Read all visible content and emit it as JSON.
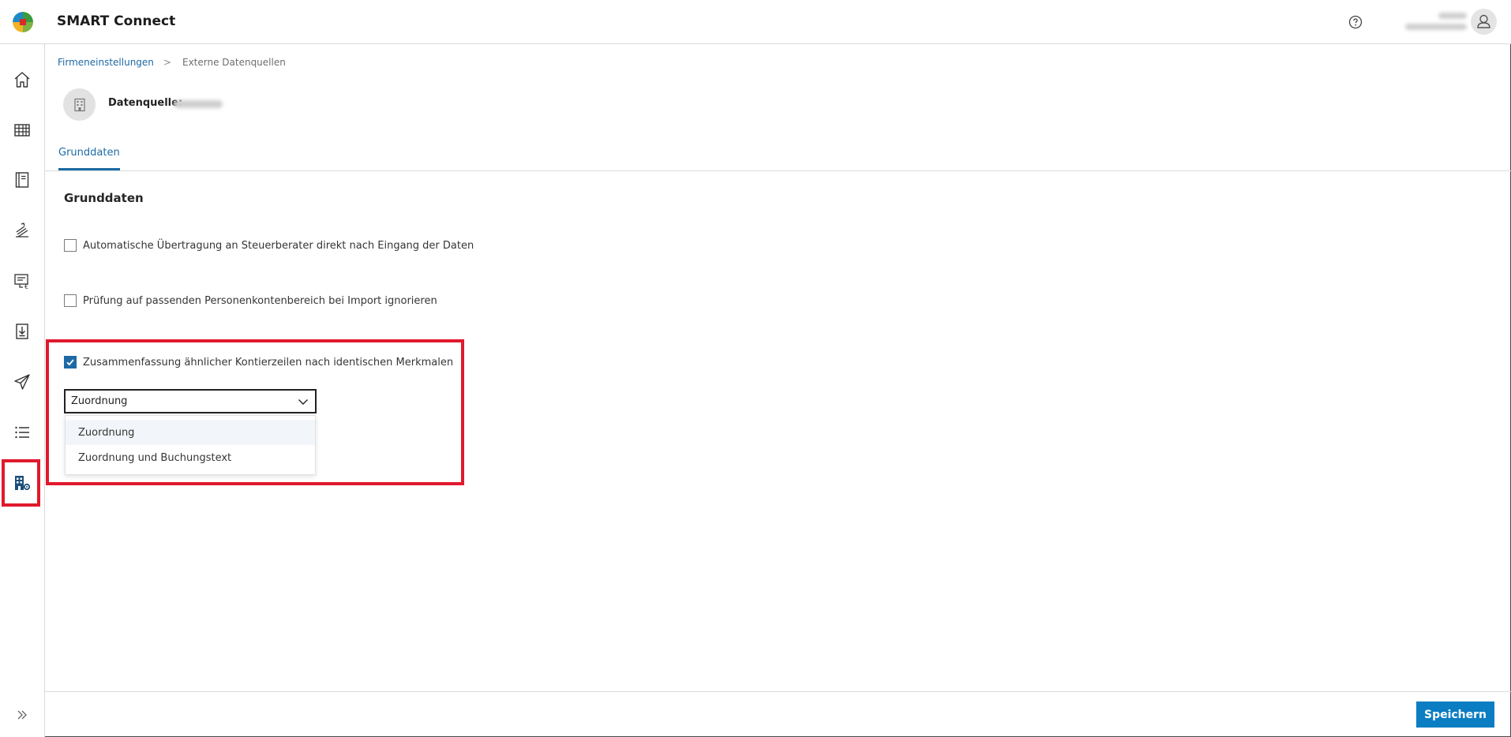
{
  "app": {
    "title": "SMART Connect"
  },
  "header": {
    "help_icon": "help-circle-icon",
    "avatar_icon": "user-icon"
  },
  "sidebar": {
    "items": [
      {
        "icon": "home-icon"
      },
      {
        "icon": "table-icon"
      },
      {
        "icon": "journal-icon"
      },
      {
        "icon": "document-stack-icon"
      },
      {
        "icon": "invoice-euro-icon"
      },
      {
        "icon": "download-icon"
      },
      {
        "icon": "send-icon"
      },
      {
        "icon": "list-icon"
      },
      {
        "icon": "building-settings-icon",
        "active": true
      }
    ],
    "expand_icon": "double-chevron-right-icon"
  },
  "breadcrumb": {
    "parent": "Firmeneinstellungen",
    "separator": ">",
    "current": "Externe Datenquellen"
  },
  "datasource": {
    "label": "Datenquelle:",
    "icon": "building-icon"
  },
  "tabs": [
    {
      "label": "Grunddaten",
      "active": true
    }
  ],
  "section": {
    "title": "Grunddaten",
    "options": [
      {
        "label": "Automatische Übertragung an Steuerberater direkt nach Eingang der Daten",
        "checked": false
      },
      {
        "label": "Prüfung auf passenden Personenkontenbereich bei Import ignorieren",
        "checked": false
      },
      {
        "label": "Zusammenfassung ähnlicher Kontierzeilen nach identischen Merkmalen",
        "checked": true
      }
    ],
    "select": {
      "value": "Zuordnung",
      "options": [
        "Zuordnung",
        "Zuordnung und Buchungstext"
      ]
    }
  },
  "footer": {
    "save_label": "Speichern"
  },
  "colors": {
    "accent": "#1c6aa5",
    "primary_button": "#0b7dc2",
    "highlight": "#e0192c"
  }
}
